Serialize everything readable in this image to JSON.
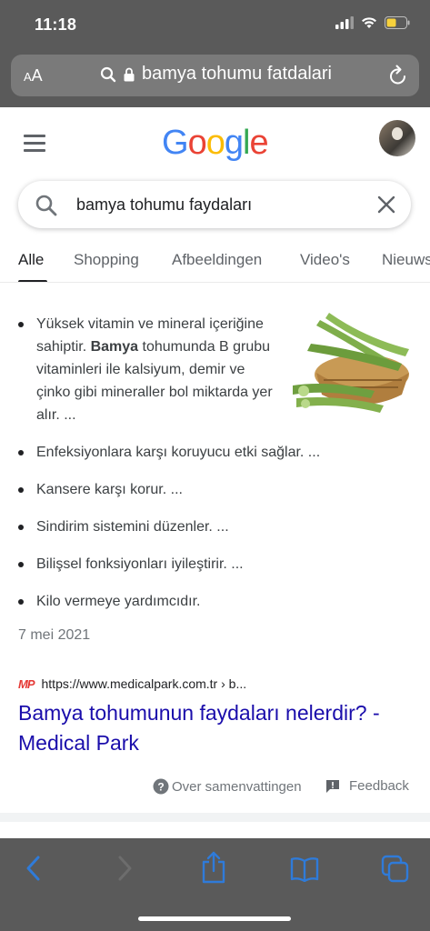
{
  "status_bar": {
    "time": "11:18"
  },
  "browser": {
    "aa_label_big": "A",
    "aa_label_small": "A",
    "url_text": "bamya tohumu fatdalari"
  },
  "google": {
    "logo_letters": [
      {
        "ch": "G",
        "color": "#4285F4"
      },
      {
        "ch": "o",
        "color": "#EA4335"
      },
      {
        "ch": "o",
        "color": "#FBBC05"
      },
      {
        "ch": "g",
        "color": "#4285F4"
      },
      {
        "ch": "l",
        "color": "#34A853"
      },
      {
        "ch": "e",
        "color": "#EA4335"
      }
    ],
    "search_query": "bamya tohumu faydaları",
    "tabs": [
      "Alle",
      "Shopping",
      "Afbeeldingen",
      "Video's",
      "Nieuws"
    ],
    "active_tab": "Alle"
  },
  "snippet": {
    "bullets": [
      {
        "pre": "Yüksek vitamin ve mineral içeriğine sahiptir. ",
        "bold": "Bamya",
        "post": " tohumunda B grubu vitaminleri ile kalsiyum, demir ve çinko gibi mineraller bol miktarda yer alır. ..."
      },
      {
        "pre": "Enfeksiyonlara karşı koruyucu etki sağlar. ...",
        "bold": "",
        "post": ""
      },
      {
        "pre": "Kansere karşı korur. ...",
        "bold": "",
        "post": ""
      },
      {
        "pre": "Sindirim sistemini düzenler. ...",
        "bold": "",
        "post": ""
      },
      {
        "pre": "Bilişsel fonksiyonları iyileştirir. ...",
        "bold": "",
        "post": ""
      },
      {
        "pre": "Kilo vermeye yardımcıdır.",
        "bold": "",
        "post": ""
      }
    ],
    "date": "7 mei 2021",
    "source_favicon": "MP",
    "source_url": "https://www.medicalpark.com.tr › b...",
    "title": "Bamya tohumunun faydaları nelerdir? - Medical Park",
    "about_label": "Over samenvattingen",
    "feedback_label": "Feedback"
  },
  "colors": {
    "chrome_gray": "#5a5a5a",
    "link_blue": "#1a0dab",
    "toolbar_icon_blue": "#2f7bd9"
  },
  "icons": {
    "search": "search-icon",
    "clear": "close-icon",
    "reload": "reload-icon",
    "lock": "lock-icon",
    "back": "chevron-left-icon",
    "forward": "chevron-right-icon",
    "share": "share-icon",
    "bookmarks": "book-icon",
    "tabs": "tabs-icon"
  }
}
